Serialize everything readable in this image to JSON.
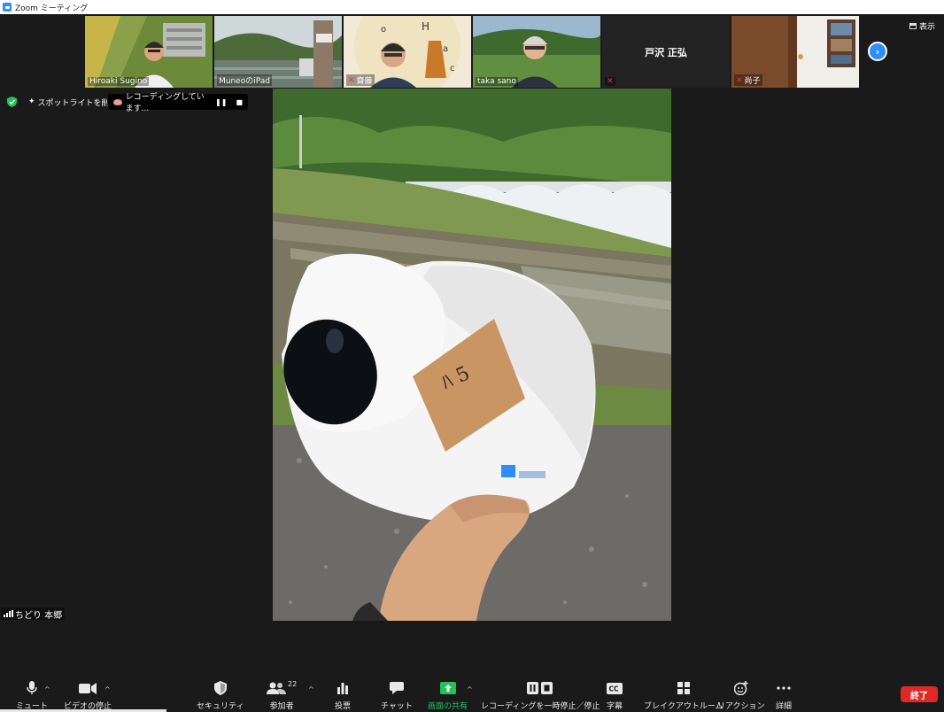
{
  "window": {
    "title": "Zoom ミーティング"
  },
  "participants": [
    {
      "name": "Hiroaki Sugino",
      "muted": false
    },
    {
      "name": "MuneoのiPad",
      "muted": false
    },
    {
      "name": "齋藤",
      "muted": true
    },
    {
      "name": "taka sano",
      "muted": false
    },
    {
      "name": "戸沢 正弘",
      "muted": true
    },
    {
      "name": "尚子",
      "muted": true
    }
  ],
  "view_label": "表示",
  "status": {
    "spotlight_label": "スポットライトを削除",
    "recording_label": "レコーディングしています..."
  },
  "active_speaker": "ちどり 本郷",
  "toolbar": {
    "mute": "ミュート",
    "video": "ビデオの停止",
    "security": "セキュリティ",
    "participants": "参加者",
    "participants_count": "22",
    "polls": "投票",
    "chat": "チャット",
    "share": "画面の共有",
    "recording": "レコーディングを一時停止／停止",
    "captions": "字幕",
    "breakout": "ブレイクアウトルーム",
    "reactions": "リアクション",
    "more": "詳細",
    "end": "終了"
  },
  "colors": {
    "accent": "#2d8cff",
    "end": "#e02828",
    "share": "#23c25a",
    "muted": "#e0353d"
  }
}
